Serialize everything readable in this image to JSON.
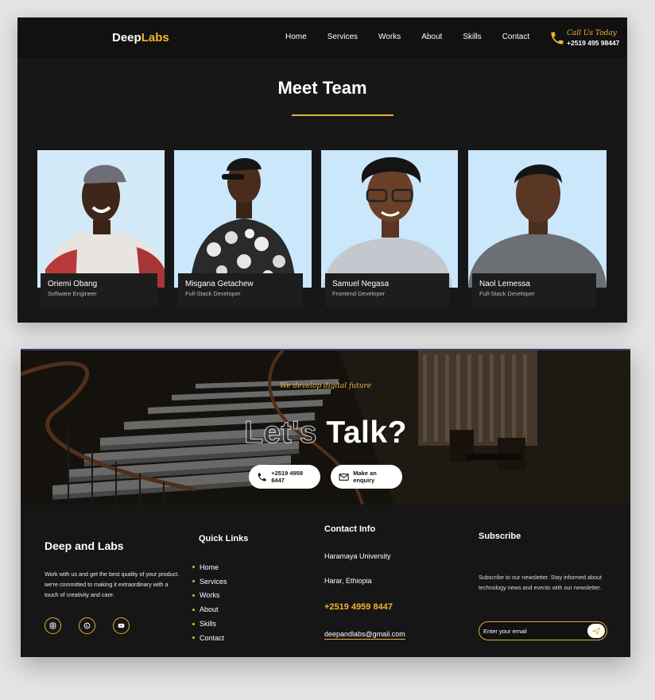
{
  "nav": {
    "logo_part1": "Deep",
    "logo_part2": "Labs",
    "links": [
      "Home",
      "Services",
      "Works",
      "About",
      "Skills",
      "Contact"
    ],
    "call_label": "Call Us Today",
    "call_number": "+2519 495 98447"
  },
  "team": {
    "title": "Meet Team",
    "members": [
      {
        "name": "Oriemi Obang",
        "role": "Software Engineer"
      },
      {
        "name": "Misgana Getachew",
        "role": "Full-Stack Developer"
      },
      {
        "name": "Samuel Negasa",
        "role": "Frontend Developer"
      },
      {
        "name": "Naol Lemessa",
        "role": "Full-Stack Developer"
      }
    ]
  },
  "hero": {
    "tagline": "We develop digital future",
    "title_outline": "Let's",
    "title_solid": "Talk?",
    "phone_button": "+2519 4959 8447",
    "enquiry_button": "Make an enquiry"
  },
  "footer": {
    "brand": "Deep and Labs",
    "about": [
      "Work with us and get the best quality of your product.",
      "we're committed to making it extraordinary with a touch of creativity and care."
    ],
    "quick_links_title": "Quick Links",
    "quick_links": [
      "Home",
      "Services",
      "Works",
      "About",
      "Skills",
      "Contact"
    ],
    "contact_title": "Contact Info",
    "university": "Haramaya University",
    "city": "Harar, Ethiopia",
    "phone": "+2519 4959 8447",
    "email": "deepandlabs@gmail.com",
    "subscribe_title": "Subscribe",
    "subscribe_text": "Subscribe to our newsletter. Stay informed about technology news and events with our newsletter.",
    "email_placeholder": "Enter your email"
  },
  "colors": {
    "accent": "#f2b52b",
    "background": "#171717",
    "photo_bg": "#cbe7fb"
  }
}
